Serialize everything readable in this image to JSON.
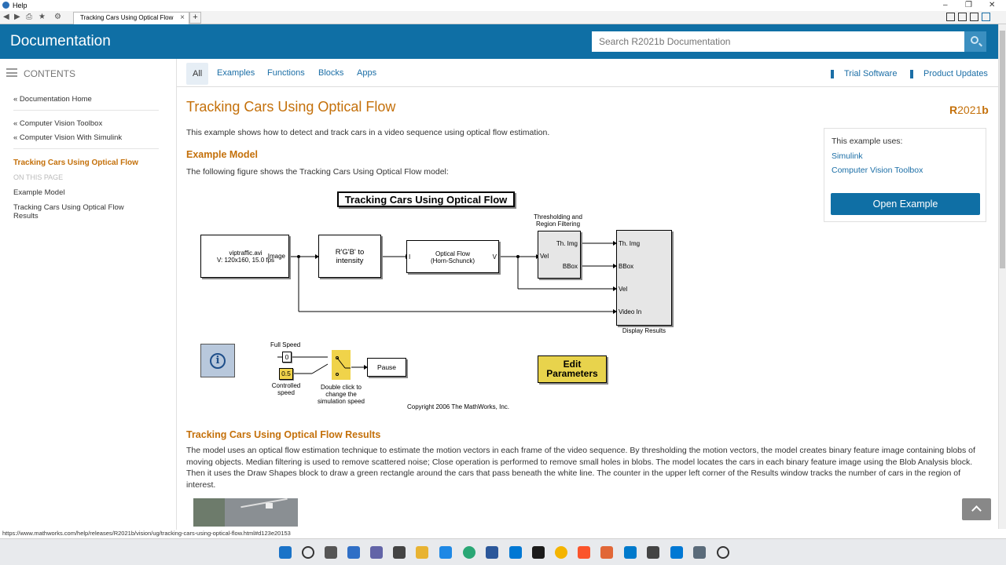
{
  "window": {
    "title": "Help"
  },
  "browser": {
    "tab_title": "Tracking Cars Using Optical Flow",
    "tab_close": "×",
    "new_tab": "+"
  },
  "header": {
    "brand": "Documentation",
    "search_placeholder": "Search R2021b Documentation"
  },
  "sidebar": {
    "contents_label": "CONTENTS",
    "links": [
      "« Documentation Home",
      "« Computer Vision Toolbox",
      "« Computer Vision With Simulink"
    ],
    "current": "Tracking Cars Using Optical Flow",
    "on_this_page": "ON THIS PAGE",
    "page_links": [
      "Example Model",
      "Tracking Cars Using Optical Flow",
      "Results"
    ]
  },
  "tabs": [
    "All",
    "Examples",
    "Functions",
    "Blocks",
    "Apps"
  ],
  "top_links": {
    "trial": "Trial Software",
    "updates": "Product Updates"
  },
  "page": {
    "title": "Tracking Cars Using Optical Flow",
    "release_r": "R",
    "release_num": "2021",
    "release_b": "b",
    "intro": "This example shows how to detect and track cars in a video sequence using optical flow estimation.",
    "section1": "Example Model",
    "section1_text": "The following figure shows the Tracking Cars Using Optical Flow model:",
    "section2": "Tracking Cars Using Optical Flow Results",
    "section2_text": "The model uses an optical flow estimation technique to estimate the motion vectors in each frame of the video sequence. By thresholding the motion vectors, the model creates binary feature image containing blobs of moving objects. Median filtering is used to remove scattered noise; Close operation is performed to remove small holes in blobs. The model locates the cars in each binary feature image using the Blob Analysis block. Then it uses the Draw Shapes block to draw a green rectangle around the cars that pass beneath the white line. The counter in the upper left corner of the Results window tracks the number of cars in the region of interest."
  },
  "uses_box": {
    "heading": "This example uses:",
    "links": [
      "Simulink",
      "Computer Vision Toolbox"
    ],
    "button": "Open Example"
  },
  "diagram": {
    "title": "Tracking Cars Using Optical Flow",
    "source_line1": "viptraffic.avi",
    "source_line2": "V: 120x160, 15.0 fps",
    "source_port": "Image",
    "convert_line1": "R'G'B' to",
    "convert_line2": "intensity",
    "flow_line1": "Optical Flow",
    "flow_line2": "(Horn-Schunck)",
    "flow_in": "I",
    "flow_out": "V",
    "thresh_label1": "Thresholding and",
    "thresh_label2": "Region Filtering",
    "thresh_in": "Vel",
    "thresh_out1": "Th. Img",
    "thresh_out2": "BBox",
    "display_ports": [
      "Th. Img",
      "BBox",
      "Vel",
      "Video In"
    ],
    "display_label": "Display Results",
    "info_symbol": "i",
    "full_speed": "Full Speed",
    "full_speed_value": "0",
    "controlled_value": "0.5",
    "controlled_line1": "Controlled",
    "controlled_line2": "speed",
    "switch_line1": "Double click to",
    "switch_line2": "change the",
    "switch_line3": "simulation speed",
    "pause": "Pause",
    "edit_line1": "Edit",
    "edit_line2": "Parameters",
    "copyright": "Copyright 2006 The MathWorks, Inc."
  },
  "status_url": "https://www.mathworks.com/help/releases/R2021b/vision/ug/tracking-cars-using-optical-flow.html#d123e20153"
}
